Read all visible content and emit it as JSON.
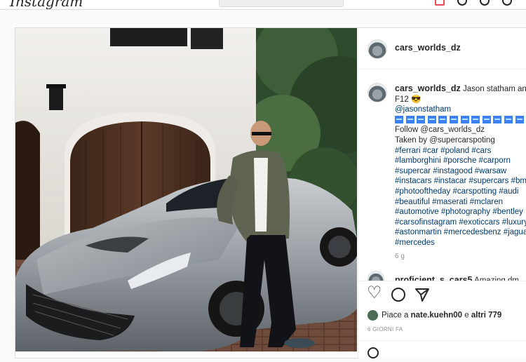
{
  "topnav": {
    "logo": "Instagram"
  },
  "post": {
    "author": "cars_worlds_dz",
    "caption": {
      "author": "cars_worlds_dz",
      "first_line": "Jason statham and his",
      "second_line": "F12 😎",
      "mention": "@jasonstatham",
      "follow": "Follow @cars_worlds_dz",
      "taken_by": "Taken by @supercarspoting",
      "hashtag_lines": [
        "#ferrari #car #poland #cars",
        "#lamborghini #porsche #carporn",
        "#supercar #instagood #warsaw",
        "#instacars #instacar #supercars #bmw",
        "#photooftheday #carspotting #audi",
        "#beautiful #maserati #mclaren",
        "#automotive #photography #bentley",
        "#carsofinstagram #exoticcars #luxury",
        "#astonmartin #mercedesbenz #jaguar",
        "#mercedes"
      ],
      "time": "6 g"
    },
    "comment_preview": {
      "user": "proficient_s_cars5",
      "text": "Amazing dm"
    },
    "likes": {
      "prefix": "Piace a ",
      "user": "nate.kuehn00",
      "middle": " e ",
      "others": "altri 779"
    },
    "time_ago": "6 GIORNI FA"
  },
  "icons": {
    "like": "heart-icon",
    "comment": "comment-icon",
    "share": "share-icon",
    "emoji": "smile-icon"
  }
}
